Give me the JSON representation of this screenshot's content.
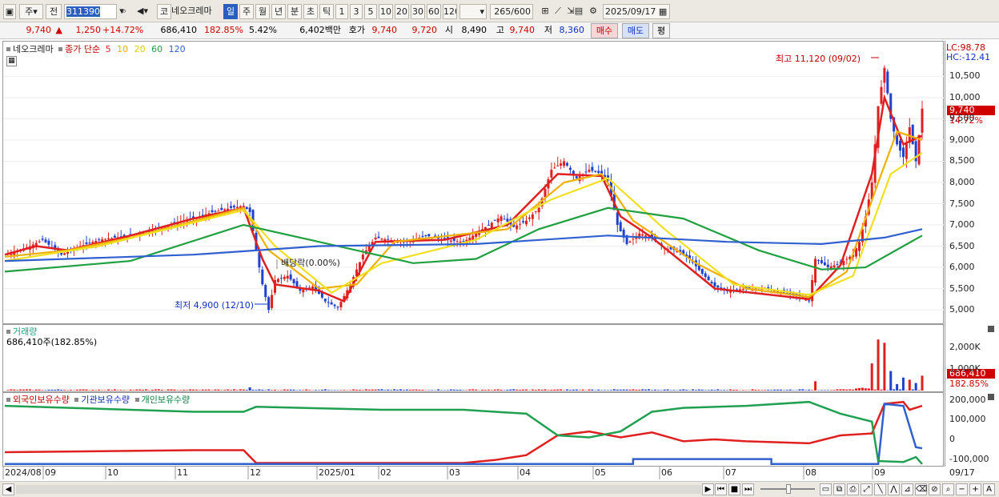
{
  "toolbar": {
    "period_prefix": "주",
    "period_type": "전",
    "code": "311390",
    "name": "네오크레마",
    "tabs": [
      "일",
      "주",
      "월",
      "년",
      "분",
      "초",
      "틱"
    ],
    "minute_units": [
      "1",
      "3",
      "5",
      "10",
      "20",
      "30",
      "60",
      "120"
    ],
    "count": "265",
    "count_max": "/600",
    "date": "2025/09/17",
    "code_btn": "코"
  },
  "quote": {
    "price": "9,740",
    "arrow": "▲",
    "change": "1,250",
    "change_pct": "+14.72%",
    "volume": "686,410",
    "vol_ratio": "182.85%",
    "turnover": "5.42%",
    "amount": "6,402백만",
    "hoga_label": "호가",
    "hoga1": "9,740",
    "hoga2": "9,720",
    "open_label": "시",
    "open": "8,490",
    "high_label": "고",
    "high": "9,740",
    "low_label": "저",
    "low": "8,360",
    "buy": "매수",
    "sell": "매도",
    "avg": "평"
  },
  "price_panel": {
    "name": "네오크레마",
    "ma_label": "종가 단순",
    "ma_periods": [
      "5",
      "10",
      "20",
      "60",
      "120"
    ],
    "ma_colors": [
      "#e02020",
      "#f0b000",
      "#f0e020",
      "#20a040",
      "#3060d0"
    ],
    "lc": "LC:98.78",
    "hc": "HC:-12.41",
    "max_note": "최고 11,120 (09/02)",
    "min_note": "최저 4,900 (12/10)",
    "dividend_note": "배당락(0.00%)",
    "yticks": [
      "10,500",
      "10,000",
      "9,500",
      "9,000",
      "8,500",
      "8,000",
      "7,500",
      "7,000",
      "6,500",
      "6,000",
      "5,500",
      "5,000"
    ],
    "current_badge": "9,740",
    "current_pct": "14.72%"
  },
  "volume_panel": {
    "title": "거래량",
    "value_text": "686,410주(182.85%)",
    "yticks": [
      "2,000K",
      "1,000K"
    ],
    "badge": "686,410",
    "badge_pct": "182.85%"
  },
  "flow_panel": {
    "legend": [
      "외국인보유수량",
      "기관보유수량",
      "개인보유수량"
    ],
    "legend_colors": [
      "#e02020",
      "#3060d0",
      "#20a040"
    ],
    "yticks": [
      "200,000",
      "100,000",
      "0",
      "-100,000"
    ]
  },
  "xaxis": [
    "2024/08",
    "09",
    "10",
    "11",
    "12",
    "2025/01",
    "02",
    "03",
    "04",
    "05",
    "06",
    "07",
    "08",
    "09",
    "09/17"
  ],
  "chart_data": {
    "type": "candlestick",
    "title": "네오크레마 (311390)",
    "price_range": [
      4700,
      11300
    ],
    "close_path": [
      [
        0,
        6300
      ],
      [
        8,
        6500
      ],
      [
        12,
        6650
      ],
      [
        18,
        6300
      ],
      [
        24,
        6500
      ],
      [
        30,
        6650
      ],
      [
        40,
        6750
      ],
      [
        50,
        6950
      ],
      [
        60,
        7150
      ],
      [
        66,
        7300
      ],
      [
        72,
        7400
      ],
      [
        76,
        7450
      ],
      [
        78,
        7300
      ],
      [
        80,
        6400
      ],
      [
        82,
        5600
      ],
      [
        84,
        5000
      ],
      [
        86,
        5700
      ],
      [
        90,
        5800
      ],
      [
        94,
        5450
      ],
      [
        98,
        5550
      ],
      [
        102,
        5200
      ],
      [
        106,
        5050
      ],
      [
        110,
        5600
      ],
      [
        114,
        6300
      ],
      [
        118,
        6700
      ],
      [
        122,
        6650
      ],
      [
        128,
        6600
      ],
      [
        134,
        6750
      ],
      [
        140,
        6650
      ],
      [
        146,
        6600
      ],
      [
        152,
        6900
      ],
      [
        158,
        7200
      ],
      [
        162,
        6950
      ],
      [
        166,
        7100
      ],
      [
        170,
        7400
      ],
      [
        174,
        8300
      ],
      [
        178,
        8500
      ],
      [
        182,
        8100
      ],
      [
        186,
        8300
      ],
      [
        190,
        8200
      ],
      [
        192,
        8050
      ],
      [
        195,
        7000
      ],
      [
        198,
        6550
      ],
      [
        202,
        6800
      ],
      [
        206,
        6700
      ],
      [
        210,
        6450
      ],
      [
        214,
        6400
      ],
      [
        218,
        6200
      ],
      [
        222,
        5850
      ],
      [
        226,
        5550
      ],
      [
        230,
        5450
      ],
      [
        236,
        5500
      ],
      [
        242,
        5500
      ],
      [
        248,
        5400
      ],
      [
        252,
        5350
      ],
      [
        256,
        5200
      ],
      [
        258,
        6200
      ],
      [
        262,
        6000
      ],
      [
        266,
        6100
      ],
      [
        270,
        6300
      ],
      [
        272,
        6600
      ],
      [
        274,
        7200
      ],
      [
        276,
        8000
      ],
      [
        278,
        9800
      ],
      [
        280,
        10700
      ],
      [
        282,
        9500
      ],
      [
        284,
        8900
      ],
      [
        286,
        8600
      ],
      [
        288,
        9300
      ],
      [
        290,
        8500
      ],
      [
        292,
        9740
      ]
    ],
    "volume_path": [
      [
        78,
        150
      ],
      [
        258,
        430
      ],
      [
        276,
        1250
      ],
      [
        278,
        2350
      ],
      [
        280,
        2200
      ],
      [
        282,
        900
      ],
      [
        284,
        300
      ],
      [
        286,
        600
      ],
      [
        288,
        500
      ],
      [
        290,
        350
      ],
      [
        292,
        686
      ]
    ],
    "volume_ylim": [
      0,
      2800
    ],
    "ma_paths": {
      "5": [
        [
          0,
          6300
        ],
        [
          10,
          6500
        ],
        [
          20,
          6400
        ],
        [
          40,
          6750
        ],
        [
          60,
          7150
        ],
        [
          76,
          7400
        ],
        [
          82,
          6200
        ],
        [
          86,
          5600
        ],
        [
          100,
          5450
        ],
        [
          108,
          5200
        ],
        [
          118,
          6600
        ],
        [
          140,
          6650
        ],
        [
          160,
          7000
        ],
        [
          176,
          8200
        ],
        [
          190,
          8150
        ],
        [
          196,
          7200
        ],
        [
          206,
          6700
        ],
        [
          226,
          5500
        ],
        [
          256,
          5250
        ],
        [
          266,
          6050
        ],
        [
          276,
          8200
        ],
        [
          280,
          10000
        ],
        [
          286,
          8900
        ],
        [
          292,
          9100
        ]
      ],
      "10": [
        [
          0,
          6250
        ],
        [
          20,
          6400
        ],
        [
          40,
          6700
        ],
        [
          76,
          7400
        ],
        [
          84,
          6400
        ],
        [
          100,
          5500
        ],
        [
          112,
          5600
        ],
        [
          124,
          6600
        ],
        [
          160,
          6900
        ],
        [
          178,
          8000
        ],
        [
          190,
          8200
        ],
        [
          200,
          7100
        ],
        [
          220,
          6100
        ],
        [
          236,
          5500
        ],
        [
          256,
          5300
        ],
        [
          268,
          5900
        ],
        [
          278,
          8000
        ],
        [
          284,
          9200
        ],
        [
          292,
          9000
        ]
      ],
      "20": [
        [
          0,
          6150
        ],
        [
          30,
          6500
        ],
        [
          76,
          7350
        ],
        [
          86,
          6500
        ],
        [
          104,
          5400
        ],
        [
          120,
          6100
        ],
        [
          150,
          6650
        ],
        [
          174,
          7600
        ],
        [
          192,
          8100
        ],
        [
          210,
          6900
        ],
        [
          232,
          5600
        ],
        [
          256,
          5350
        ],
        [
          270,
          5800
        ],
        [
          282,
          8200
        ],
        [
          292,
          8700
        ]
      ],
      "60": [
        [
          0,
          5900
        ],
        [
          40,
          6150
        ],
        [
          76,
          7000
        ],
        [
          100,
          6600
        ],
        [
          130,
          6100
        ],
        [
          150,
          6200
        ],
        [
          170,
          6900
        ],
        [
          192,
          7400
        ],
        [
          216,
          7150
        ],
        [
          240,
          6400
        ],
        [
          260,
          5950
        ],
        [
          274,
          6000
        ],
        [
          292,
          6750
        ]
      ],
      "120": [
        [
          0,
          6150
        ],
        [
          60,
          6300
        ],
        [
          100,
          6500
        ],
        [
          150,
          6550
        ],
        [
          192,
          6750
        ],
        [
          230,
          6600
        ],
        [
          260,
          6550
        ],
        [
          280,
          6700
        ],
        [
          292,
          6900
        ]
      ]
    },
    "holdings_ylim": [
      -130000,
      215000
    ],
    "foreign": [
      [
        0,
        -65000
      ],
      [
        60,
        -55000
      ],
      [
        76,
        -55000
      ],
      [
        80,
        -120000
      ],
      [
        120,
        -120000
      ],
      [
        146,
        -120000
      ],
      [
        156,
        -105000
      ],
      [
        166,
        -80000
      ],
      [
        176,
        20000
      ],
      [
        186,
        40000
      ],
      [
        196,
        10000
      ],
      [
        206,
        35000
      ],
      [
        216,
        -10000
      ],
      [
        226,
        0
      ],
      [
        236,
        -10000
      ],
      [
        256,
        -20000
      ],
      [
        266,
        20000
      ],
      [
        276,
        30000
      ],
      [
        280,
        180000
      ],
      [
        286,
        190000
      ],
      [
        288,
        150000
      ],
      [
        292,
        170000
      ]
    ],
    "institution": [
      [
        0,
        -125000
      ],
      [
        200,
        -125000
      ],
      [
        200,
        -100000
      ],
      [
        244,
        -100000
      ],
      [
        244,
        -125000
      ],
      [
        278,
        -125000
      ],
      [
        280,
        180000
      ],
      [
        286,
        170000
      ],
      [
        290,
        -40000
      ],
      [
        292,
        -45000
      ]
    ],
    "individual": [
      [
        0,
        170000
      ],
      [
        60,
        140000
      ],
      [
        76,
        140000
      ],
      [
        80,
        165000
      ],
      [
        120,
        150000
      ],
      [
        146,
        150000
      ],
      [
        156,
        140000
      ],
      [
        166,
        130000
      ],
      [
        176,
        20000
      ],
      [
        186,
        10000
      ],
      [
        196,
        40000
      ],
      [
        206,
        140000
      ],
      [
        216,
        160000
      ],
      [
        236,
        170000
      ],
      [
        256,
        190000
      ],
      [
        266,
        130000
      ],
      [
        276,
        90000
      ],
      [
        278,
        -110000
      ],
      [
        286,
        -115000
      ],
      [
        290,
        -90000
      ],
      [
        292,
        -125000
      ]
    ]
  }
}
